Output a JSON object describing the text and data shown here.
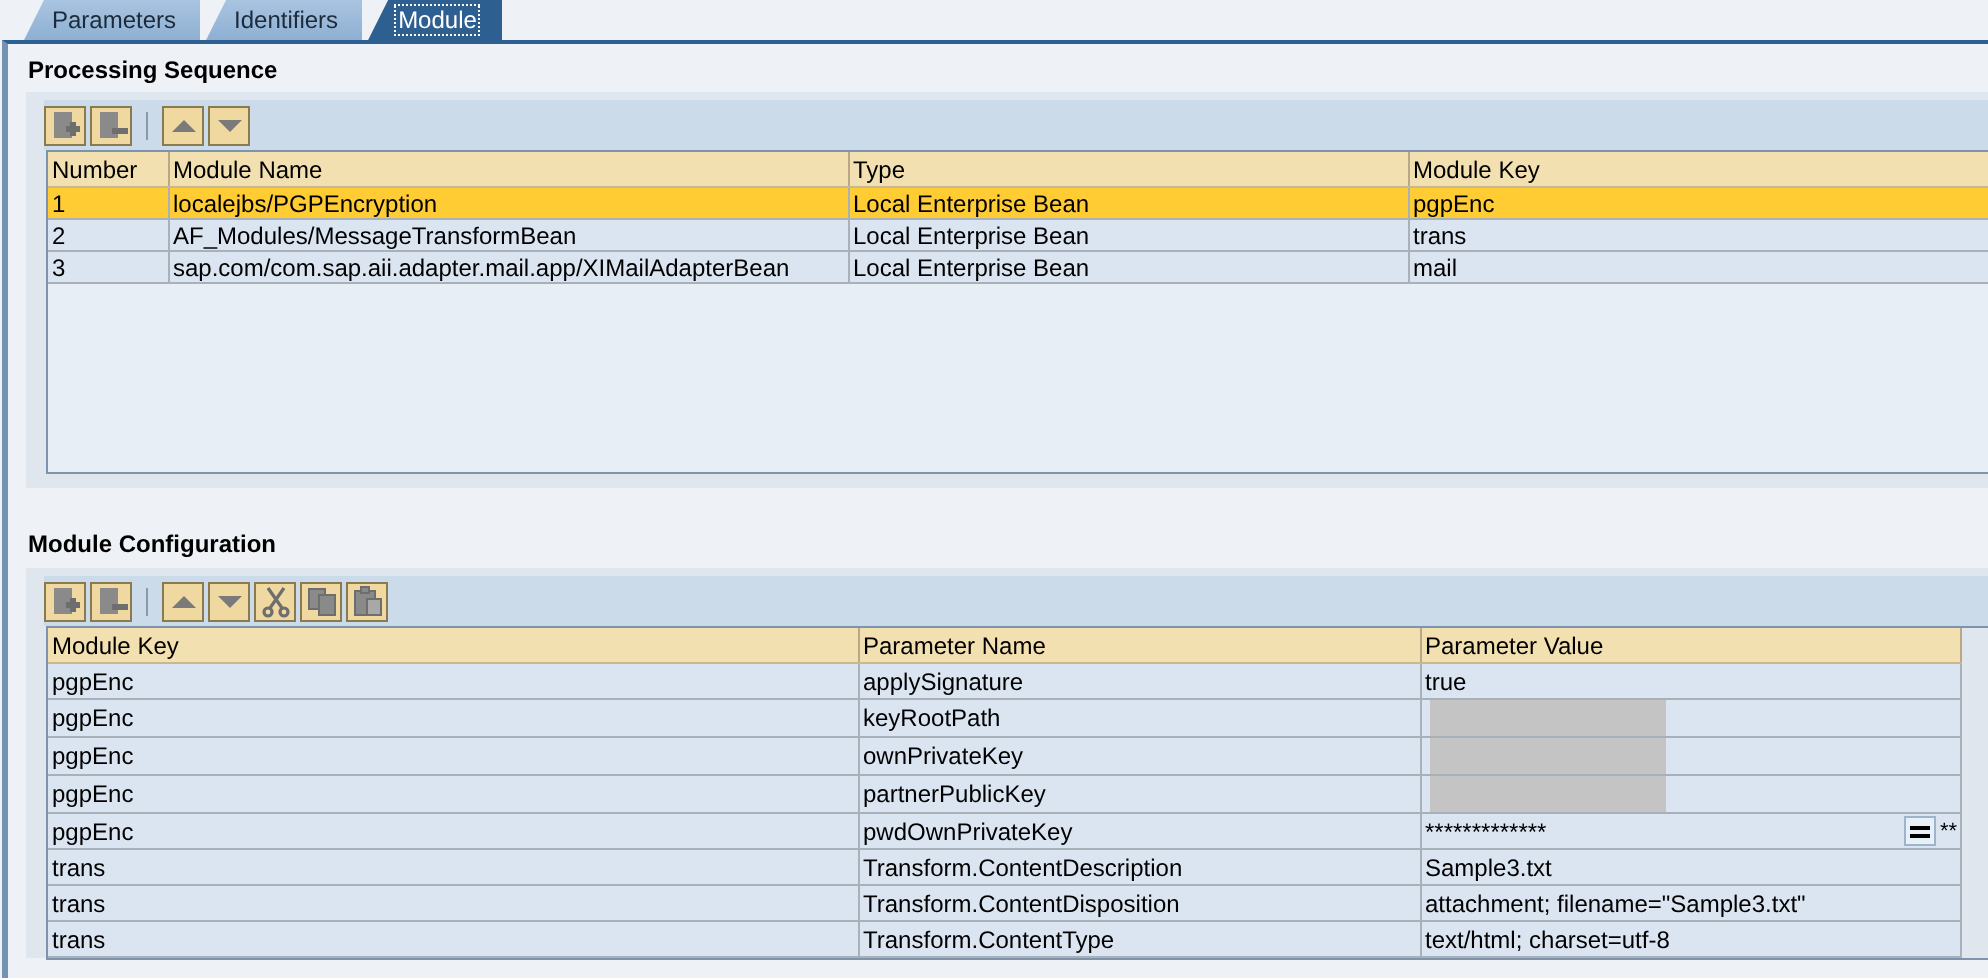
{
  "tabs": [
    {
      "label": "Parameters",
      "selected": false
    },
    {
      "label": "Identifiers",
      "selected": false
    },
    {
      "label": "Module",
      "selected": true
    }
  ],
  "processing_sequence": {
    "title": "Processing Sequence",
    "toolbar": [
      {
        "kind": "insert-row"
      },
      {
        "kind": "delete-row"
      },
      {
        "kind": "separator"
      },
      {
        "kind": "move-up"
      },
      {
        "kind": "move-down"
      }
    ],
    "columns": [
      "Number",
      "Module Name",
      "Type",
      "Module Key"
    ],
    "rows": [
      {
        "cells": [
          "1",
          "localejbs/PGPEncryption",
          "Local Enterprise Bean",
          "pgpEnc"
        ],
        "selected": true
      },
      {
        "cells": [
          "2",
          "AF_Modules/MessageTransformBean",
          "Local Enterprise Bean",
          "trans"
        ],
        "selected": false
      },
      {
        "cells": [
          "3",
          "sap.com/com.sap.aii.adapter.mail.app/XIMailAdapterBean",
          "Local Enterprise Bean",
          "mail"
        ],
        "selected": false
      }
    ]
  },
  "module_configuration": {
    "title": "Module Configuration",
    "toolbar": [
      {
        "kind": "insert-row"
      },
      {
        "kind": "delete-row"
      },
      {
        "kind": "separator"
      },
      {
        "kind": "move-up"
      },
      {
        "kind": "move-down"
      },
      {
        "kind": "cut"
      },
      {
        "kind": "copy"
      },
      {
        "kind": "paste"
      }
    ],
    "columns": [
      "Module Key",
      "Parameter Name",
      "Parameter Value"
    ],
    "rows": [
      {
        "module_key": "pgpEnc",
        "name": "applySignature",
        "value": "true",
        "redacted": false
      },
      {
        "module_key": "pgpEnc",
        "name": "keyRootPath",
        "redacted": true
      },
      {
        "module_key": "pgpEnc",
        "name": "ownPrivateKey",
        "redacted": true
      },
      {
        "module_key": "pgpEnc",
        "name": "partnerPublicKey",
        "redacted": true
      },
      {
        "module_key": "pgpEnc",
        "name": "pwdOwnPrivateKey",
        "value": "*************",
        "redacted": false,
        "editor_button": true,
        "overflow": "**"
      },
      {
        "module_key": "trans",
        "name": "Transform.ContentDescription",
        "value": "Sample3.txt",
        "redacted": false
      },
      {
        "module_key": "trans",
        "name": "Transform.ContentDisposition",
        "value": "attachment; filename=\"Sample3.txt\"",
        "redacted": false
      },
      {
        "module_key": "trans",
        "name": "Transform.ContentType",
        "value": "text/html; charset=utf-8",
        "redacted": false
      }
    ]
  }
}
